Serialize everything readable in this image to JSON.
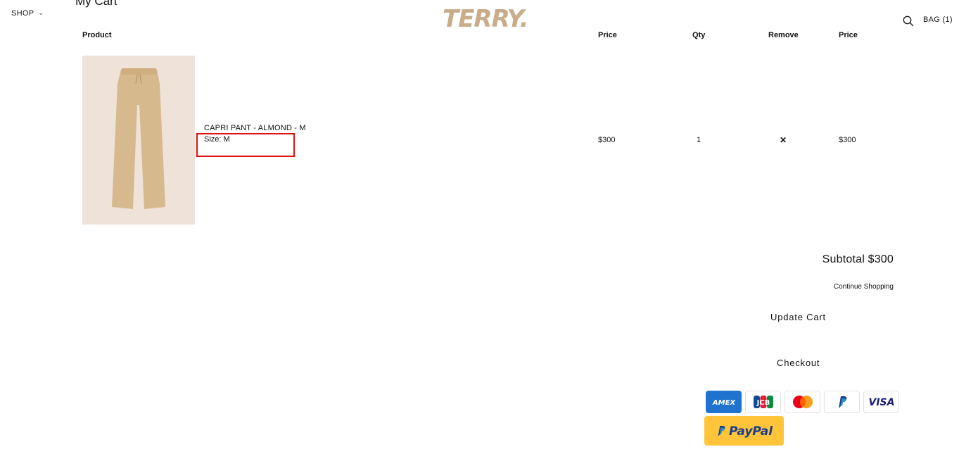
{
  "page_title": "My Cart",
  "nav": {
    "shop_label": "SHOP",
    "bag_label": "BAG (1)"
  },
  "brand": {
    "logo_text": "TERRY.",
    "logo_color": "#c9ad8a"
  },
  "cart_table": {
    "headers": {
      "product": "Product",
      "price": "Price",
      "qty": "Qty",
      "remove": "Remove",
      "total": "Price"
    },
    "items": [
      {
        "name": "CAPRI PANT - ALMOND - M",
        "size_label": "Size: M",
        "price": "$300",
        "qty": "1",
        "total": "$300",
        "image_bg": "#efe2d9",
        "product_color": "#d8b88a"
      }
    ]
  },
  "summary": {
    "subtotal": "Subtotal $300",
    "continue_shopping": "Continue Shopping",
    "update_cart": "Update Cart",
    "checkout": "Checkout"
  },
  "payment_methods": [
    "amex-icon",
    "jcb-icon",
    "mastercard-icon",
    "paypal-icon",
    "visa-icon"
  ],
  "payment_labels": {
    "amex": "AMEX",
    "jcb": "JCB",
    "visa": "VISA",
    "paypal_button": "PayPal"
  },
  "colors": {
    "highlight": "#e01010",
    "paypal_button_bg": "#ffc439"
  }
}
